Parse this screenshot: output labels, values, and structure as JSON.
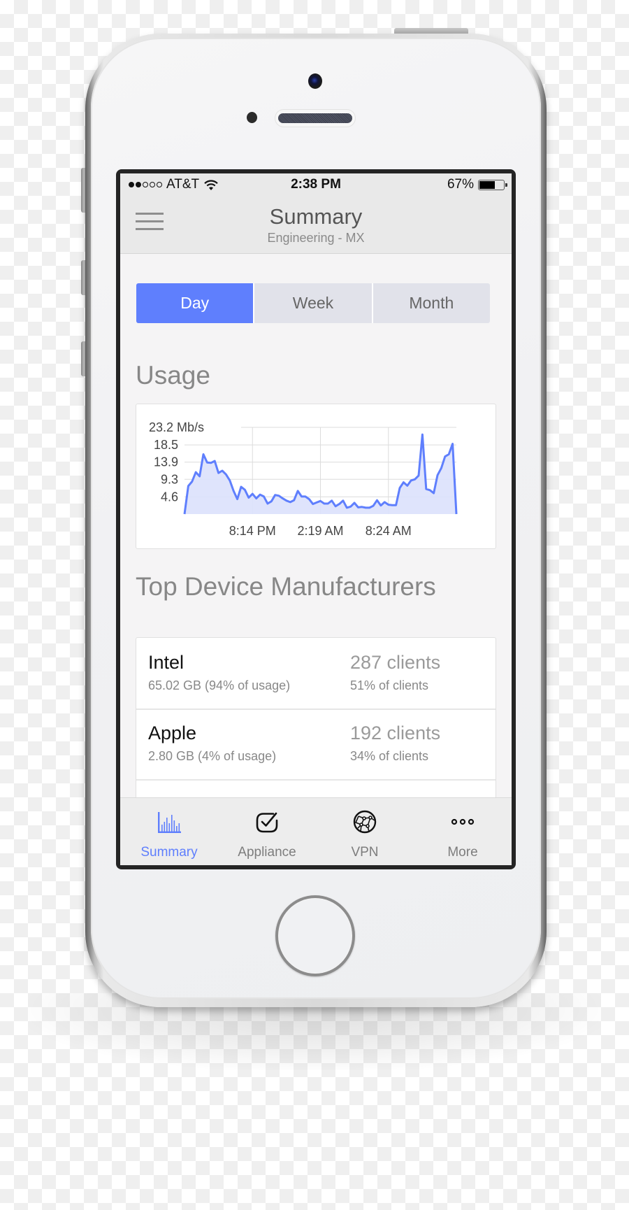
{
  "status_bar": {
    "signal_filled": 2,
    "signal_total": 5,
    "carrier": "AT&T",
    "time": "2:38 PM",
    "battery_text": "67%",
    "battery_level": 0.67
  },
  "header": {
    "title": "Summary",
    "subtitle": "Engineering - MX"
  },
  "segments": {
    "options": [
      "Day",
      "Week",
      "Month"
    ],
    "selected": "Day"
  },
  "usage": {
    "heading": "Usage"
  },
  "chart_data": {
    "type": "area",
    "title": "Usage",
    "unit": "Mb/s",
    "yticks": [
      4.6,
      9.3,
      13.9,
      18.5,
      23.2
    ],
    "ytick_labels": [
      "4.6",
      "9.3",
      "13.9",
      "18.5",
      "23.2 Mb/s"
    ],
    "ylim": [
      0,
      23.2
    ],
    "xtick_labels": [
      "8:14 PM",
      "2:19 AM",
      "8:24 AM"
    ],
    "xtick_positions": [
      0.25,
      0.5,
      0.75
    ],
    "grid": true,
    "legend": "none",
    "color": "#5f7ffd",
    "fill": "#dbe1fc",
    "values": [
      0,
      7.5,
      8.7,
      11.2,
      10.1,
      16.0,
      13.8,
      13.7,
      14.2,
      11.0,
      11.6,
      10.6,
      9.0,
      6.2,
      4.0,
      7.3,
      6.5,
      4.4,
      5.4,
      4.2,
      5.2,
      4.7,
      2.8,
      3.4,
      5.1,
      4.9,
      4.2,
      3.6,
      3.2,
      3.7,
      6.2,
      4.7,
      4.7,
      4.0,
      2.7,
      3.1,
      3.5,
      2.8,
      2.8,
      3.6,
      2.1,
      2.7,
      3.6,
      1.7,
      2.0,
      3.0,
      1.8,
      1.9,
      1.7,
      1.7,
      2.2,
      3.7,
      2.3,
      3.2,
      2.5,
      2.4,
      2.4,
      7.0,
      8.5,
      7.6,
      9.0,
      9.3,
      10.3,
      21.3,
      6.7,
      6.4,
      5.6,
      10.4,
      12.3,
      15.4,
      16.0,
      18.8,
      0
    ]
  },
  "manufacturers": {
    "heading": "Top Device Manufacturers",
    "items": [
      {
        "name": "Intel",
        "usage": "65.02 GB (94% of usage)",
        "clients": "287 clients",
        "client_pct": "51% of clients"
      },
      {
        "name": "Apple",
        "usage": "2.80 GB (4% of usage)",
        "clients": "192 clients",
        "client_pct": "34% of clients"
      }
    ]
  },
  "tabbar": {
    "items": [
      {
        "label": "Summary",
        "icon": "bar-chart-icon",
        "active": true
      },
      {
        "label": "Appliance",
        "icon": "checkbox-icon",
        "active": false
      },
      {
        "label": "VPN",
        "icon": "globe-network-icon",
        "active": false
      },
      {
        "label": "More",
        "icon": "more-dots-icon",
        "active": false
      }
    ]
  }
}
